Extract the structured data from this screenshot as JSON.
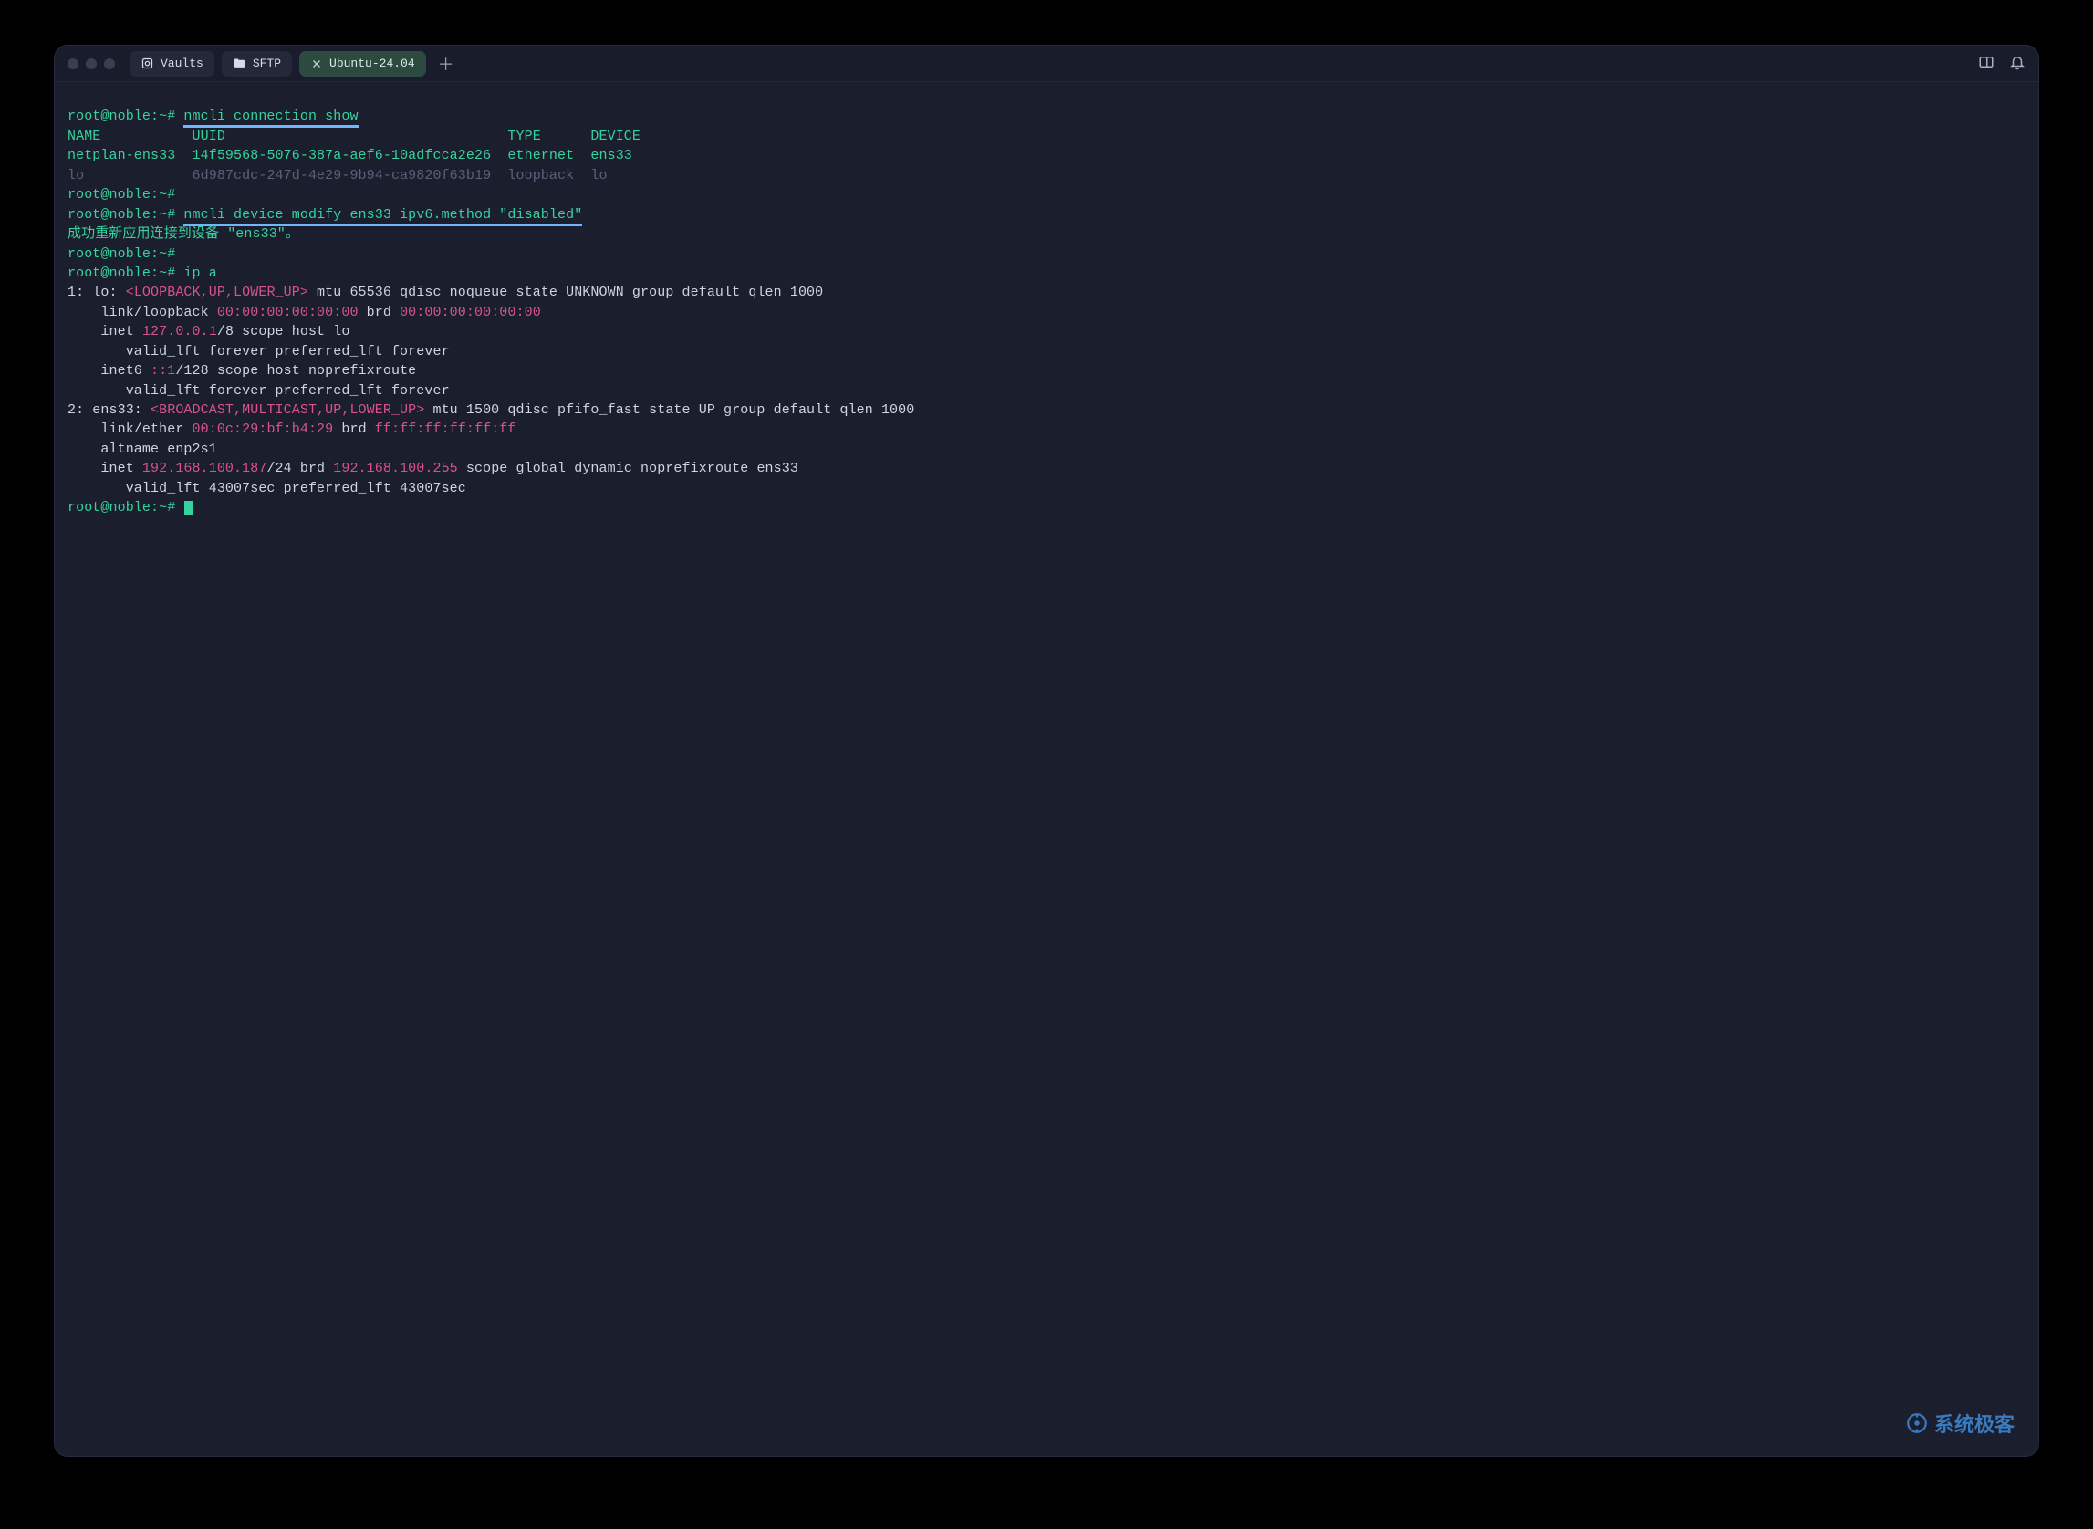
{
  "tabs": {
    "items": [
      {
        "icon": "vault-icon",
        "label": "Vaults",
        "closable": false
      },
      {
        "icon": "folder-icon",
        "label": "SFTP",
        "closable": false
      },
      {
        "icon": "close-icon",
        "label": "Ubuntu-24.04",
        "closable": true
      }
    ],
    "active_index": 2,
    "add_tab_glyph": "＋"
  },
  "prompts": {
    "p1": "root@noble:~# ",
    "p2": "root@noble:~#",
    "hash_only": "# "
  },
  "commands": {
    "c1": "nmcli connection show",
    "c2": "nmcli device modify ens33 ipv6.method \"disabled\"",
    "c3": "ip a"
  },
  "table": {
    "hdr_name": "NAME",
    "hdr_uuid": "UUID",
    "hdr_type": "TYPE",
    "hdr_device": "DEVICE",
    "r1_name": "netplan-ens33",
    "r1_uuid": "14f59568-5076-387a-aef6-10adfcca2e26",
    "r1_type": "ethernet",
    "r1_device": "ens33",
    "r2_name": "lo",
    "r2_uuid": "6d987cdc-247d-4e29-9b94-ca9820f63b19",
    "r2_type": "loopback",
    "r2_device": "lo"
  },
  "msg_success": "成功重新应用连接到设备 \"ens33\"。",
  "ip": {
    "l1a": "1: lo: ",
    "l1b": "<LOOPBACK,UP,LOWER_UP>",
    "l1c": " mtu 65536 qdisc noqueue state UNKNOWN group default qlen 1000",
    "l2a": "    link/loopback ",
    "l2b": "00:00:00:00:00:00",
    "l2c": " brd ",
    "l2d": "00:00:00:00:00:00",
    "l3a": "    inet ",
    "l3b": "127.0.0.1",
    "l3c": "/8 scope host lo",
    "l4": "       valid_lft forever preferred_lft forever",
    "l5a": "    inet6 ",
    "l5b": "::1",
    "l5c": "/128 scope host noprefixroute",
    "l6": "       valid_lft forever preferred_lft forever",
    "l7a": "2: ens33: ",
    "l7b": "<BROADCAST,MULTICAST,UP,LOWER_UP>",
    "l7c": " mtu 1500 qdisc pfifo_fast state UP group default qlen 1000",
    "l8a": "    link/ether ",
    "l8b": "00:0c:29:bf:b4:29",
    "l8c": " brd ",
    "l8d": "ff:ff:ff:ff:ff:ff",
    "l9": "    altname enp2s1",
    "l10a": "    inet ",
    "l10b": "192.168.100.187",
    "l10c": "/24 brd ",
    "l10d": "192.168.100.255",
    "l10e": " scope global dynamic noprefixroute ens33",
    "l11": "       valid_lft 43007sec preferred_lft 43007sec"
  },
  "watermark": "系统极客"
}
